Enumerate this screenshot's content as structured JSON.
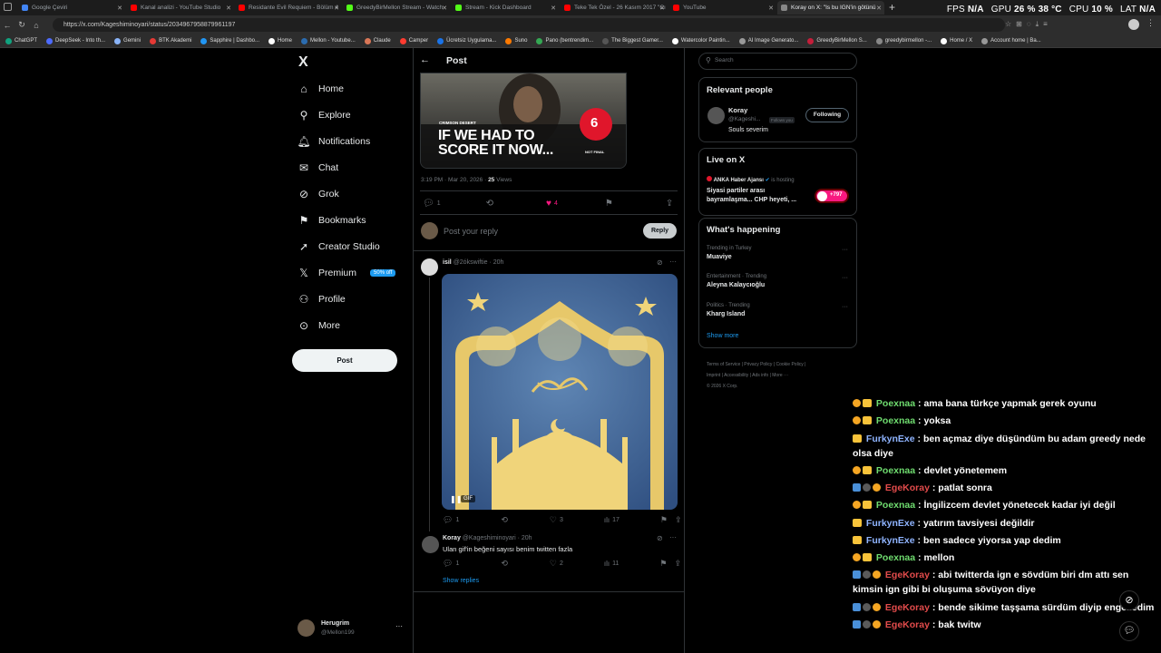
{
  "browser": {
    "tabs": [
      {
        "title": "Google Çeviri",
        "color": "#4285f4"
      },
      {
        "title": "Kanal analizi - YouTube Studio",
        "color": "#ff0000"
      },
      {
        "title": "Residante Evil Requiem - Bölüm 4",
        "color": "#ff0000"
      },
      {
        "title": "GreedyBirMellon Stream - Watch",
        "color": "#53fc18"
      },
      {
        "title": "Stream - Kick Dashboard",
        "color": "#53fc18"
      },
      {
        "title": "Teke Tek Özel - 26 Kasım 2017 \"Cı",
        "color": "#ff0000"
      },
      {
        "title": "YouTube",
        "color": "#ff0000"
      },
      {
        "title": "Koray on X: \"Is bu IGN'in götünü",
        "color": "#000000"
      }
    ],
    "new_tab": "+",
    "url": "https://x.com/Kageshiminoyari/status/2034967958879961197",
    "bookmarks": [
      "ChatGPT",
      "DeepSeek - Into th...",
      "Gemini",
      "BTK Akademi",
      "Sapphire | Dashbo...",
      "Home",
      "Mellon - Youtube...",
      "Claude",
      "Camper",
      "Ücretsiz Uygulama...",
      "Suno",
      "Pano (bentrendim...",
      "The Biggest Gamer...",
      "Watercolor Paintin...",
      "AI Image Generato...",
      "GreedyBirMellon S...",
      "greedybirmellon -...",
      "Home / X",
      "Account home | Ba..."
    ]
  },
  "overlay": {
    "fps_label": "FPS",
    "fps_value": "N/A",
    "gpu_label": "GPU",
    "gpu_value": "26 %",
    "gpu_temp": "38 °C",
    "cpu_label": "CPU",
    "cpu_value": "10 %",
    "lat_label": "LAT",
    "lat_value": "N/A"
  },
  "nav": {
    "logo": "X",
    "items": [
      {
        "label": "Home",
        "icon": "home-icon",
        "glyph": "⌂"
      },
      {
        "label": "Explore",
        "icon": "search-icon",
        "glyph": "⚲"
      },
      {
        "label": "Notifications",
        "icon": "bell-icon",
        "glyph": "🔔︎"
      },
      {
        "label": "Chat",
        "icon": "mail-icon",
        "glyph": "✉"
      },
      {
        "label": "Grok",
        "icon": "grok-icon",
        "glyph": "⊘"
      },
      {
        "label": "Bookmarks",
        "icon": "bookmark-icon",
        "glyph": "⚑"
      },
      {
        "label": "Creator Studio",
        "icon": "rocket-icon",
        "glyph": "➚"
      },
      {
        "label": "Premium",
        "icon": "x-premium-icon",
        "glyph": "𝕏"
      },
      {
        "label": "Profile",
        "icon": "person-icon",
        "glyph": "⚇"
      },
      {
        "label": "More",
        "icon": "more-circle-icon",
        "glyph": "⊙"
      }
    ],
    "premium_badge": "50% off",
    "post_button": "Post",
    "account_name": "Herugrim",
    "account_handle": "@Mellon199",
    "account_more": "···"
  },
  "post": {
    "header_title": "Post",
    "image_headline_1": "IF WE HAD TO",
    "image_headline_2": "SCORE IT NOW...",
    "image_game": "CRIMSON DESERT",
    "image_score": "6",
    "image_score_note": "NOT FINAL",
    "timestamp": "3:19 PM · Mar 20, 2026 · ",
    "views_count": "25",
    "views_label": " Views",
    "replies": "1",
    "likes": "4",
    "reply_placeholder": "Post your reply",
    "reply_button": "Reply"
  },
  "reply1": {
    "name": "isil",
    "handle": "@2ókswiftie · 20h",
    "gif_label": "GIF",
    "replies": "1",
    "likes": "3",
    "views": "17"
  },
  "reply2": {
    "name": "Koray",
    "handle": "@Kageshiminoyari · 20h",
    "text": "Ulan gif'in beğeni sayısı benim twitten fazla",
    "replies": "1",
    "likes": "2",
    "views": "11",
    "show_replies": "Show replies"
  },
  "right": {
    "search_placeholder": "Search",
    "relevant_title": "Relevant people",
    "person_name": "Koray",
    "person_handle": "@Kageshi...",
    "follows_you": "Follows you",
    "following_button": "Following",
    "person_bio": "Souls severim",
    "live_title": "Live on X",
    "live_host": "ANKA Haber Ajansı",
    "live_hosting": " is hosting",
    "live_text_1": "Siyasi partiler arası",
    "live_text_2": "bayramlaşma... CHP heyeti, ...",
    "live_count": "+797",
    "happening_title": "What's happening",
    "trends": [
      {
        "context": "Trending in Turkey",
        "name": "Muaviye"
      },
      {
        "context": "Entertainment · Trending",
        "name": "Aleyna Kalaycıoğlu"
      },
      {
        "context": "Politics · Trending",
        "name": "Kharg Island"
      }
    ],
    "show_more": "Show more",
    "footer_line_1": "Terms of Service  |  Privacy Policy  |  Cookie Policy  |",
    "footer_line_2": "Imprint  |  Accessibility  |  Ads info  |  More ···",
    "footer_line_3": "© 2026 X Corp."
  },
  "chat": [
    {
      "user": "Poexnaa",
      "color": "#6fdc6f",
      "badges": [
        "bo",
        "by"
      ],
      "text": " : ama bana türkçe yapmak gerek oyunu"
    },
    {
      "user": "Poexnaa",
      "color": "#6fdc6f",
      "badges": [
        "bo",
        "by"
      ],
      "text": " : yoksa"
    },
    {
      "user": "FurkynExe",
      "color": "#8fb4ff",
      "badges": [
        "by"
      ],
      "text": " : ben açmaz diye düşündüm bu adam greedy nede olsa diye"
    },
    {
      "user": "Poexnaa",
      "color": "#6fdc6f",
      "badges": [
        "bo",
        "by"
      ],
      "text": " : devlet yönetemem"
    },
    {
      "user": "EgeKoray",
      "color": "#e24b4b",
      "badges": [
        "bb",
        "bg",
        "bo"
      ],
      "text": " : patlat sonra"
    },
    {
      "user": "Poexnaa",
      "color": "#6fdc6f",
      "badges": [
        "bo",
        "by"
      ],
      "text": " : İngilizcem devlet yönetecek kadar iyi değil"
    },
    {
      "user": "FurkynExe",
      "color": "#8fb4ff",
      "badges": [
        "by"
      ],
      "text": " : yatırım tavsiyesi değildir"
    },
    {
      "user": "FurkynExe",
      "color": "#8fb4ff",
      "badges": [
        "by"
      ],
      "text": " : ben sadece yiyorsa yap dedim"
    },
    {
      "user": "Poexnaa",
      "color": "#6fdc6f",
      "badges": [
        "bo",
        "by"
      ],
      "text": " : mellon"
    },
    {
      "user": "EgeKoray",
      "color": "#e24b4b",
      "badges": [
        "bb",
        "bg",
        "bo"
      ],
      "text": " : abi twitterda ign e sövdüm biri dm attı sen kimsin ign gibi bi oluşuma sövüyon diye"
    },
    {
      "user": "EgeKoray",
      "color": "#e24b4b",
      "badges": [
        "bb",
        "bg",
        "bo"
      ],
      "text": " : bende sikime taşşama sürdüm diyip engelledim"
    },
    {
      "user": "EgeKoray",
      "color": "#e24b4b",
      "badges": [
        "bb",
        "bg",
        "bo"
      ],
      "text": " : bak twitw"
    }
  ]
}
